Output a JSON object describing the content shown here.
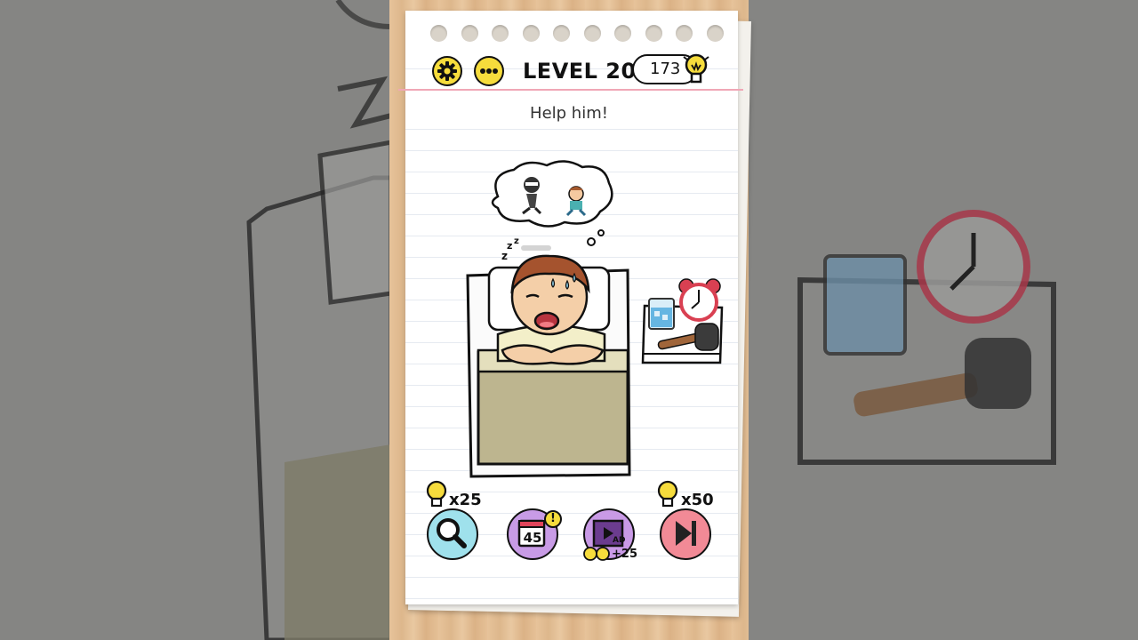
{
  "header": {
    "level_label": "LEVEL 209",
    "hint_count": "173",
    "settings_icon": "gear-icon",
    "more_icon": "more-dots-icon",
    "hint_icon": "lightbulb-icon"
  },
  "prompt": "Help him!",
  "toolbar": {
    "zoom_cost": "x25",
    "skip_cost": "x50",
    "daily_date": "45",
    "daily_badge": "!",
    "ad_label": "AD",
    "ad_reward": "+25"
  },
  "colors": {
    "accent_yellow": "#f6dc3c",
    "zoom_button": "#9fe1ec",
    "daily_button": "#c89be6",
    "ad_button": "#c99ae6",
    "skip_button": "#f28a96",
    "margin_line": "#f0a7b6"
  }
}
